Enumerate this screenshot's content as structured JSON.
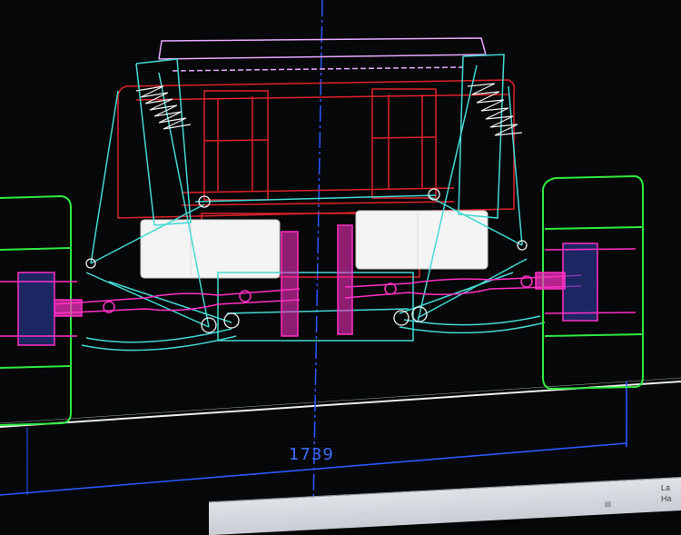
{
  "drawing": {
    "dimension_label": "1739",
    "left_wheel_dim": "",
    "center_dim": ""
  },
  "status_bar": {
    "file_text": "",
    "side_text": "La\nHa"
  },
  "colors": {
    "background": "#050607",
    "red": "#e0202a",
    "cyan": "#42d9d4",
    "magenta": "#ff2fc6",
    "green": "#2dea3f",
    "blue": "#2a57ff",
    "white": "#f2f2f2",
    "lavender": "#e8a8ff"
  }
}
